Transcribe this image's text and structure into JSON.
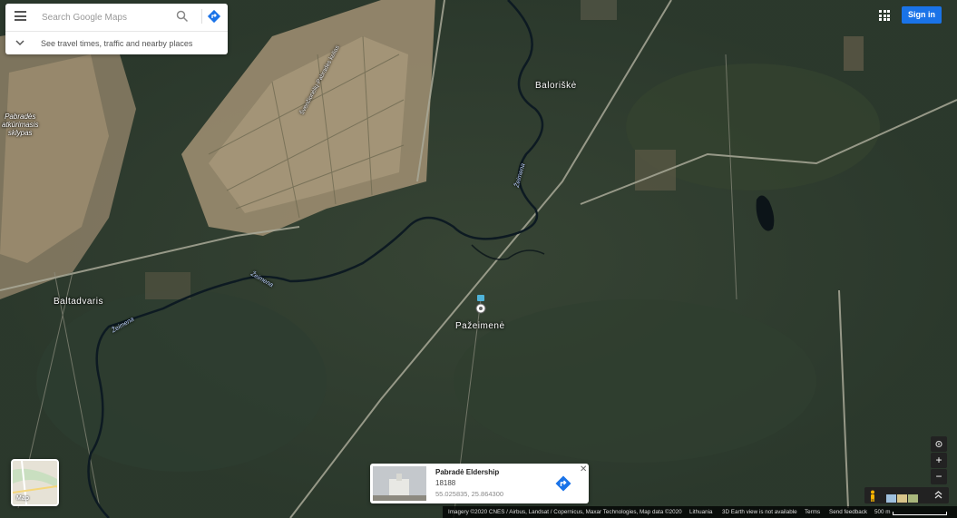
{
  "search": {
    "placeholder": "Search Google Maps",
    "travel_hint": "See travel times, traffic and nearby places"
  },
  "header": {
    "sign_in_label": "Sign in"
  },
  "map_labels": {
    "places": [
      "Baltadvaris",
      "Pažeimenė",
      "Baloriškė"
    ],
    "pabrade_area": [
      "Pabradės",
      "atkūrimasis",
      "sklypas"
    ],
    "rivers": [
      "Žeimena",
      "Žeimena",
      "Žeimena"
    ],
    "road_label": "Švenčionėlių-Pabradės kelias"
  },
  "info_card": {
    "title": "Pabradė Eldership",
    "postal_code": "18188",
    "coordinates": "55.025835, 25.864300"
  },
  "map_type": {
    "label": "Map"
  },
  "controls": {
    "zoom_in": "+",
    "zoom_out": "−"
  },
  "footer": {
    "attribution": "Imagery ©2020 CNES / Airbus, Landsat / Copernicus, Maxar Technologies, Map data ©2020",
    "country": "Lithuania",
    "earth_note": "3D Earth view is not available",
    "terms": "Terms",
    "feedback": "Send feedback",
    "scale": "500 m"
  },
  "colors": {
    "accent": "#1a73e8",
    "forest": "#2b3a2c",
    "sand": "#b9a88a"
  }
}
